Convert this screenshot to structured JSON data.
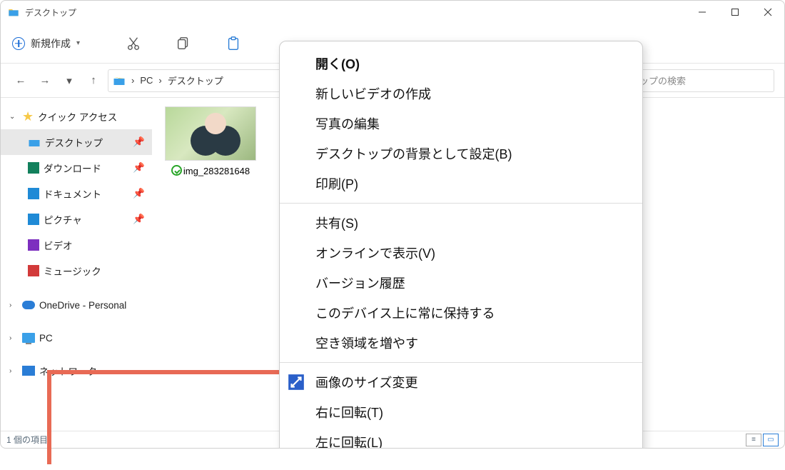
{
  "window_title": "デスクトップ",
  "toolbar": {
    "new_label": "新規作成"
  },
  "breadcrumb": {
    "segments": [
      "PC",
      "デスクトップ"
    ],
    "search_placeholder": "デスクトップの検索"
  },
  "sidebar": {
    "quick_access": "クイック アクセス",
    "desktop": "デスクトップ",
    "downloads": "ダウンロード",
    "documents": "ドキュメント",
    "pictures": "ピクチャ",
    "videos": "ビデオ",
    "music": "ミュージック",
    "onedrive": "OneDrive - Personal",
    "pc": "PC",
    "network": "ネットワーク"
  },
  "file": {
    "name": "img_283281648"
  },
  "status": {
    "item_count": "1 個の項目"
  },
  "context_menu": {
    "open": "開く(O)",
    "new_video": "新しいビデオの作成",
    "edit_photo": "写真の編集",
    "set_background": "デスクトップの背景として設定(B)",
    "print": "印刷(P)",
    "share": "共有(S)",
    "view_online": "オンラインで表示(V)",
    "version_history": "バージョン履歴",
    "always_keep": "このデバイス上に常に保持する",
    "free_space": "空き領域を増やす",
    "resize_image": "画像のサイズ変更",
    "rotate_right": "右に回転(T)",
    "rotate_left": "左に回転(L)"
  }
}
